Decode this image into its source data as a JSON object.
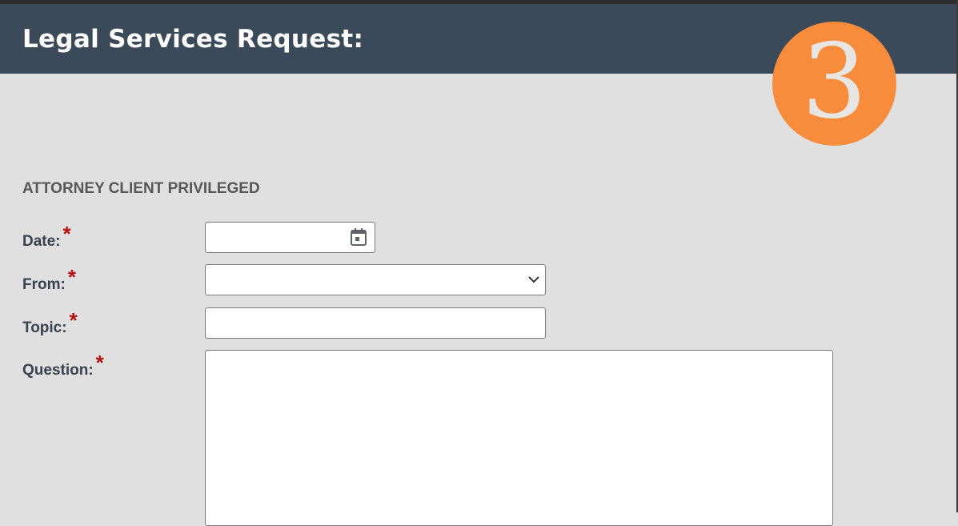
{
  "header": {
    "title": "Legal Services Request:",
    "step_badge": "3"
  },
  "form": {
    "section_heading": "ATTORNEY CLIENT PRIVILEGED",
    "required_marker": "*",
    "fields": {
      "date": {
        "label": "Date:",
        "value": "",
        "icon": "calendar-icon"
      },
      "from": {
        "label": "From:",
        "selected": "",
        "icon": "chevron-down-icon"
      },
      "topic": {
        "label": "Topic:",
        "value": ""
      },
      "question": {
        "label": "Question:",
        "value": ""
      }
    }
  },
  "colors": {
    "header_bg": "#3a4a59",
    "badge_bg": "#f78c3c",
    "page_bg": "#e0e0e0",
    "required": "#b50f0f"
  }
}
